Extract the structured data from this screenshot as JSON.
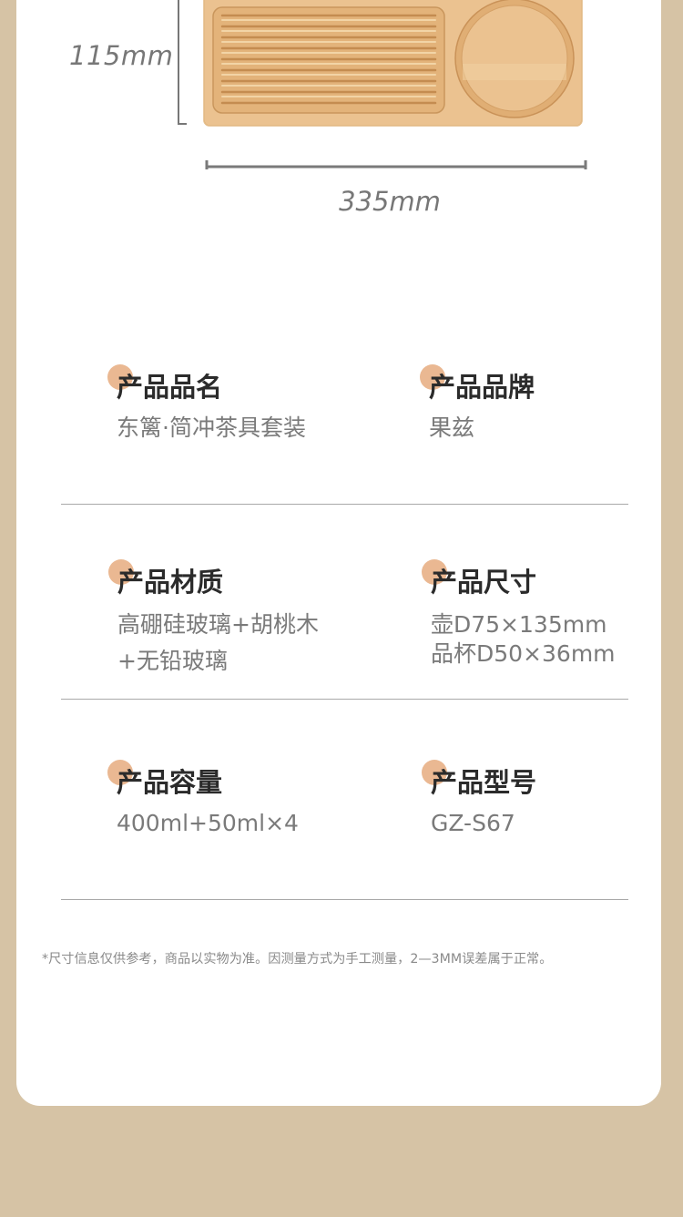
{
  "dimensions": {
    "height_label": "115mm",
    "width_label": "335mm"
  },
  "specs": [
    {
      "label": "产品品名",
      "lines": [
        "东篱·简冲茶具套装"
      ]
    },
    {
      "label": "产品品牌",
      "lines": [
        "果兹"
      ]
    },
    {
      "label": "产品材质",
      "lines": [
        "高硼硅玻璃+胡桃木",
        "+无铅玻璃"
      ]
    },
    {
      "label": "产品尺寸",
      "lines": [
        "壶D75×135mm",
        "品杯D50×36mm"
      ]
    },
    {
      "label": "产品容量",
      "lines": [
        "400ml+50ml×4"
      ]
    },
    {
      "label": "产品型号",
      "lines": [
        "GZ-S67"
      ]
    }
  ],
  "footnote": "*尺寸信息仅供参考，商品以实物为准。因测量方式为手工测量，2—3MM误差属于正常。",
  "colors": {
    "background": "#d6c3a5",
    "card": "#ffffff",
    "accent_dot": "#eab892",
    "wood": "#ecc594"
  }
}
